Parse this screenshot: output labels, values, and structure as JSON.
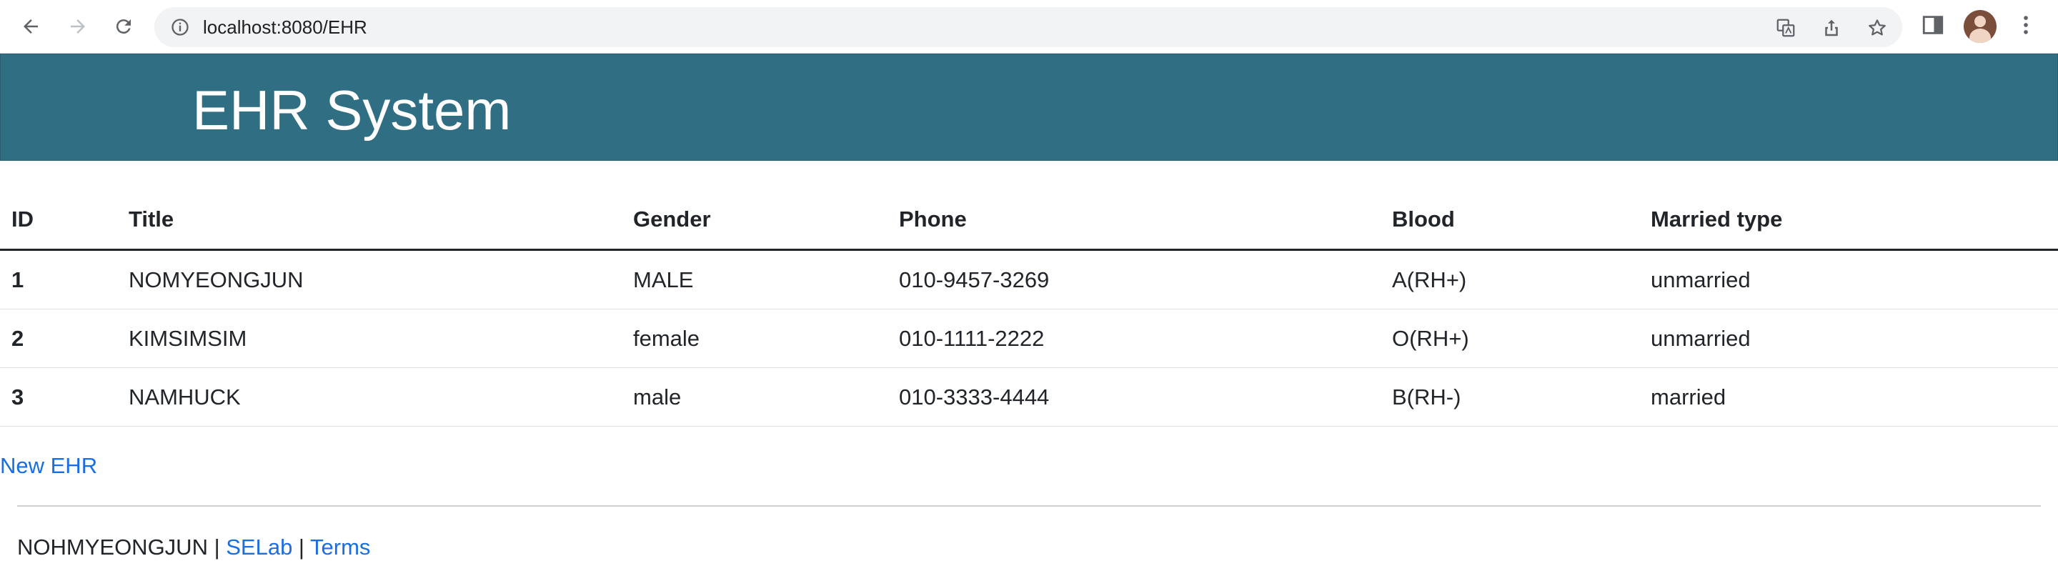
{
  "browser": {
    "url": "localhost:8080/EHR"
  },
  "app": {
    "title": "EHR System"
  },
  "table": {
    "columns": [
      "ID",
      "Title",
      "Gender",
      "Phone",
      "Blood",
      "Married type"
    ],
    "rows": [
      [
        "1",
        "NOMYEONGJUN",
        "MALE",
        "010-9457-3269",
        "A(RH+)",
        "unmarried"
      ],
      [
        "2",
        "KIMSIMSIM",
        "female",
        "010-1111-2222",
        "O(RH+)",
        "unmarried"
      ],
      [
        "3",
        "NAMHUCK",
        "male",
        "010-3333-4444",
        "B(RH-)",
        "married"
      ]
    ]
  },
  "actions": {
    "new_label": "New EHR"
  },
  "footer": {
    "author": "NOHMYEONGJUN",
    "sep1": " | ",
    "lab_link": "SELab",
    "sep2": " | ",
    "terms_link": "Terms"
  },
  "colors": {
    "header_bg": "#306f83",
    "link": "#1a6fe0"
  }
}
